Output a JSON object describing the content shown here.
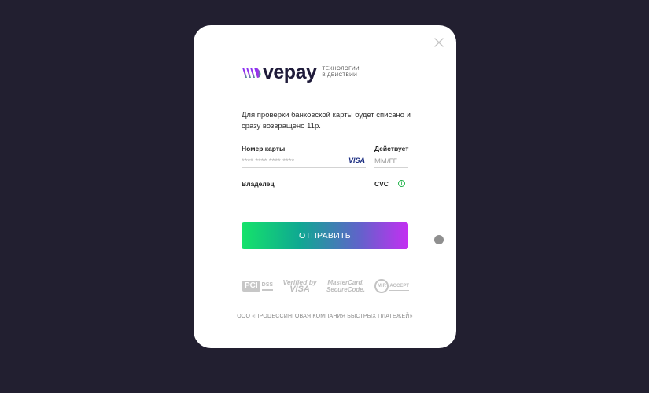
{
  "brand": {
    "name": "vepay",
    "tagline_line1": "технологии",
    "tagline_line2": "в действии",
    "colors": {
      "mark_start": "#7b2ff7",
      "mark_end": "#22c55e",
      "text": "#1f1b3a"
    }
  },
  "close": {
    "icon": "close-icon"
  },
  "notice": "Для проверки банковской карты будет списано и сразу возвращено 11р.",
  "form": {
    "card_number": {
      "label": "Номер карты",
      "placeholder": "**** **** **** ****",
      "value": ""
    },
    "card_brand": "VISA",
    "expiry": {
      "label": "Действует",
      "placeholder": "ММ/ГГ",
      "value": ""
    },
    "holder": {
      "label": "Владелец",
      "placeholder": "",
      "value": ""
    },
    "cvc": {
      "label": "CVC",
      "placeholder": "",
      "value": "",
      "info_icon": "info-icon"
    },
    "submit_label": "ОТПРАВИТЬ"
  },
  "security_logos": {
    "pci": "PCI",
    "pci_dss": "DSS",
    "verified_line1": "Verified by",
    "verified_line2": "VISA",
    "mastercard_line1": "MasterCard.",
    "mastercard_line2": "SecureCode.",
    "mir_badge": "MIR",
    "mir_text": "ACCEPT"
  },
  "company": "ООО «ПРОЦЕССИНГОВАЯ КОМПАНИЯ БЫСТРЫХ ПЛАТЕЖЕЙ»",
  "colors": {
    "background": "#221f30",
    "modal": "#ffffff",
    "button_gradient": [
      "#15e36a",
      "#0fa892",
      "#5f64c9",
      "#c42ff2"
    ],
    "info_green": "#21b34a"
  }
}
